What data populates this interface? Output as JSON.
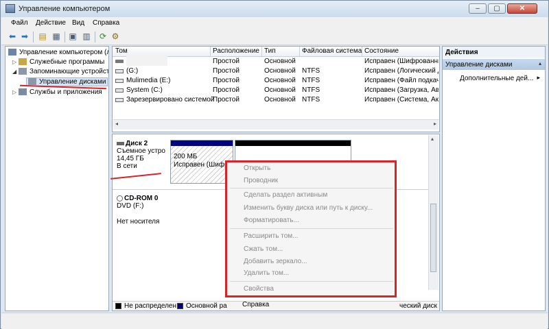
{
  "window": {
    "title": "Управление компьютером",
    "buttons": {
      "minimize": "–",
      "maximize": "▢",
      "close": "✕"
    }
  },
  "menu": [
    "Файл",
    "Действие",
    "Вид",
    "Справка"
  ],
  "tree": {
    "root": "Управление компьютером (л",
    "items": [
      "Служебные программы",
      "Запоминающие устройст",
      "Управление дисками",
      "Службы и приложения"
    ]
  },
  "table": {
    "columns": [
      "Том",
      "Расположение",
      "Тип",
      "Файловая система",
      "Состояние"
    ],
    "rows": [
      {
        "volume": "",
        "layout": "Простой",
        "type": "Основной",
        "fs": "",
        "status": "Исправен (Шифрованны"
      },
      {
        "volume": "(G:)",
        "layout": "Простой",
        "type": "Основной",
        "fs": "NTFS",
        "status": "Исправен (Логический д"
      },
      {
        "volume": "Mulimedia (E:)",
        "layout": "Простой",
        "type": "Основной",
        "fs": "NTFS",
        "status": "Исправен (Файл подкачи"
      },
      {
        "volume": "System (C:)",
        "layout": "Простой",
        "type": "Основной",
        "fs": "NTFS",
        "status": "Исправен (Загрузка, Ава"
      },
      {
        "volume": "Зарезервировано системой",
        "layout": "Простой",
        "type": "Основной",
        "fs": "NTFS",
        "status": "Исправен (Система, Акти"
      }
    ]
  },
  "disks": [
    {
      "name": "Диск 2",
      "kind": "Съемное устро",
      "size": "14,45 ГБ",
      "state": "В сети",
      "partition": {
        "size": "200 МБ",
        "status": "Исправен (Шифр"
      }
    },
    {
      "name": "CD-ROM 0",
      "kind": "DVD (F:)",
      "state": "Нет носителя"
    }
  ],
  "legend": {
    "unallocated": "Не распределен",
    "primary": "Основной ра",
    "logical": "ческий диск"
  },
  "context_menu": {
    "items": [
      "Открыть",
      "Проводник",
      "Сделать раздел активным",
      "Изменить букву диска или путь к диску...",
      "Форматировать...",
      "Расширить том...",
      "Сжать том...",
      "Добавить зеркало...",
      "Удалить том...",
      "Свойства",
      "Справка"
    ]
  },
  "actions": {
    "header": "Действия",
    "section": "Управление дисками",
    "more": "Дополнительные дей..."
  },
  "colors": {
    "primary": "#000080",
    "unallocated": "#000000",
    "annotation": "#d9222a"
  }
}
